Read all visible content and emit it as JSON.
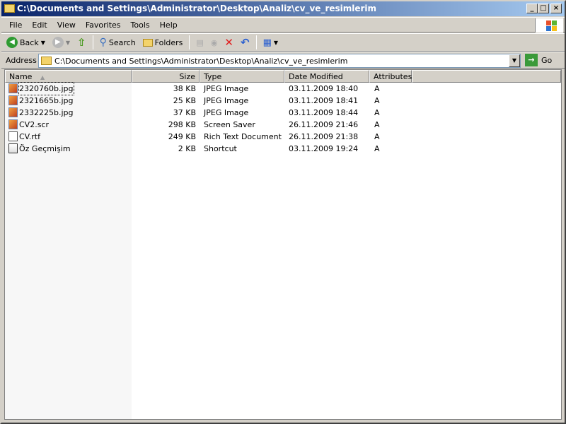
{
  "window": {
    "title": "C:\\Documents and Settings\\Administrator\\Desktop\\Analiz\\cv_ve_resimlerim"
  },
  "menu": [
    "File",
    "Edit",
    "View",
    "Favorites",
    "Tools",
    "Help"
  ],
  "toolbar": {
    "back": "Back",
    "search": "Search",
    "folders": "Folders"
  },
  "address": {
    "label": "Address",
    "value": "C:\\Documents and Settings\\Administrator\\Desktop\\Analiz\\cv_ve_resimlerim",
    "go": "Go"
  },
  "columns": [
    "Name",
    "Size",
    "Type",
    "Date Modified",
    "Attributes"
  ],
  "files": [
    {
      "name": "2320760b.jpg",
      "size": "38 KB",
      "type": "JPEG Image",
      "date": "03.11.2009 18:40",
      "attr": "A",
      "icon": "jpeg-icon"
    },
    {
      "name": "2321665b.jpg",
      "size": "25 KB",
      "type": "JPEG Image",
      "date": "03.11.2009 18:41",
      "attr": "A",
      "icon": "jpeg-icon"
    },
    {
      "name": "2332225b.jpg",
      "size": "37 KB",
      "type": "JPEG Image",
      "date": "03.11.2009 18:44",
      "attr": "A",
      "icon": "jpeg-icon"
    },
    {
      "name": "CV2.scr",
      "size": "298 KB",
      "type": "Screen Saver",
      "date": "26.11.2009 21:46",
      "attr": "A",
      "icon": "screensaver-icon"
    },
    {
      "name": "CV.rtf",
      "size": "249 KB",
      "type": "Rich Text Document",
      "date": "26.11.2009 21:38",
      "attr": "A",
      "icon": "rtf-icon"
    },
    {
      "name": "Öz Geçmişim",
      "size": "2 KB",
      "type": "Shortcut",
      "date": "03.11.2009 19:24",
      "attr": "A",
      "icon": "shortcut-icon"
    }
  ]
}
